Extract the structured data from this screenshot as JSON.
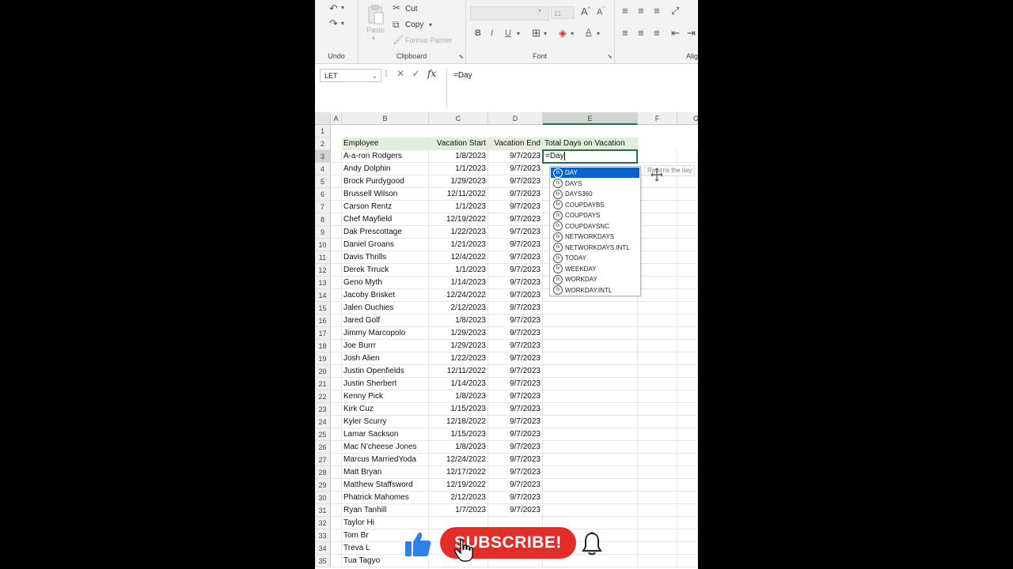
{
  "ribbon": {
    "undo_label": "Undo",
    "clipboard_label": "Clipboard",
    "font_label": "Font",
    "alignment_label": "Alig",
    "cut_label": "Cut",
    "copy_label": "Copy",
    "paste_label": "Paste",
    "format_painter_label": "Format Painter",
    "font_size": "11"
  },
  "formula_bar": {
    "name_box": "LET",
    "formula": "=Day"
  },
  "columns": [
    "A",
    "B",
    "C",
    "D",
    "E",
    "F",
    "G"
  ],
  "header_row": {
    "row": "2",
    "employee": "Employee",
    "vacation_start": "Vacation Start",
    "vacation_end": "Vacation End",
    "total_days": "Total Days on Vacation"
  },
  "active_cell": {
    "value": "=Day"
  },
  "rows": [
    {
      "num": "3",
      "name": "A-a-ron Rodgers",
      "start": "1/8/2023",
      "end": "9/7/2023"
    },
    {
      "num": "4",
      "name": "Andy Dolphin",
      "start": "1/1/2023",
      "end": "9/7/2023"
    },
    {
      "num": "5",
      "name": "Brock Purdygood",
      "start": "1/29/2023",
      "end": "9/7/2023"
    },
    {
      "num": "6",
      "name": "Brussell Wilson",
      "start": "12/11/2022",
      "end": "9/7/2023"
    },
    {
      "num": "7",
      "name": "Carson Rentz",
      "start": "1/1/2023",
      "end": "9/7/2023"
    },
    {
      "num": "8",
      "name": "Chef Mayfield",
      "start": "12/19/2022",
      "end": "9/7/2023"
    },
    {
      "num": "9",
      "name": "Dak Prescottage",
      "start": "1/22/2023",
      "end": "9/7/2023"
    },
    {
      "num": "10",
      "name": "Daniel Groans",
      "start": "1/21/2023",
      "end": "9/7/2023"
    },
    {
      "num": "11",
      "name": "Davis Thrills",
      "start": "12/4/2022",
      "end": "9/7/2023"
    },
    {
      "num": "12",
      "name": "Derek Trruck",
      "start": "1/1/2023",
      "end": "9/7/2023"
    },
    {
      "num": "13",
      "name": "Geno Myth",
      "start": "1/14/2023",
      "end": "9/7/2023"
    },
    {
      "num": "14",
      "name": "Jacoby Brisket",
      "start": "12/24/2022",
      "end": "9/7/2023"
    },
    {
      "num": "15",
      "name": "Jalen Ouchies",
      "start": "2/12/2023",
      "end": "9/7/2023"
    },
    {
      "num": "16",
      "name": "Jared Golf",
      "start": "1/8/2023",
      "end": "9/7/2023"
    },
    {
      "num": "17",
      "name": "Jimmy Marcopolo",
      "start": "1/29/2023",
      "end": "9/7/2023"
    },
    {
      "num": "18",
      "name": "Joe Burrr",
      "start": "1/29/2023",
      "end": "9/7/2023"
    },
    {
      "num": "19",
      "name": "Josh Alien",
      "start": "1/22/2023",
      "end": "9/7/2023"
    },
    {
      "num": "20",
      "name": "Justin Openfields",
      "start": "12/11/2022",
      "end": "9/7/2023"
    },
    {
      "num": "21",
      "name": "Justin Sherbert",
      "start": "1/14/2023",
      "end": "9/7/2023"
    },
    {
      "num": "22",
      "name": "Kenny Pick",
      "start": "1/8/2023",
      "end": "9/7/2023"
    },
    {
      "num": "23",
      "name": "Kirk Cuz",
      "start": "1/15/2023",
      "end": "9/7/2023"
    },
    {
      "num": "24",
      "name": "Kyler Scurry",
      "start": "12/18/2022",
      "end": "9/7/2023"
    },
    {
      "num": "25",
      "name": "Lamar Sackson",
      "start": "1/15/2023",
      "end": "9/7/2023"
    },
    {
      "num": "26",
      "name": "Mac N'cheese Jones",
      "start": "1/8/2023",
      "end": "9/7/2023"
    },
    {
      "num": "27",
      "name": "Marcus MarriedYoda",
      "start": "12/24/2022",
      "end": "9/7/2023"
    },
    {
      "num": "28",
      "name": "Matt Bryan",
      "start": "12/17/2022",
      "end": "9/7/2023"
    },
    {
      "num": "29",
      "name": "Matthew Staffsword",
      "start": "12/19/2022",
      "end": "9/7/2023"
    },
    {
      "num": "30",
      "name": "Phatrick Mahomes",
      "start": "2/12/2023",
      "end": "9/7/2023"
    },
    {
      "num": "31",
      "name": "Ryan Tanhill",
      "start": "1/7/2023",
      "end": "9/7/2023"
    },
    {
      "num": "32",
      "name": "Taylor Hi",
      "start": "",
      "end": ""
    },
    {
      "num": "33",
      "name": "Tom Br",
      "start": "",
      "end": ""
    },
    {
      "num": "34",
      "name": "Treva L",
      "start": "",
      "end": ""
    },
    {
      "num": "35",
      "name": "Tua Tagyo",
      "start": "",
      "end": ""
    }
  ],
  "empty_rows": [
    "1"
  ],
  "autocomplete": {
    "items": [
      "DAY",
      "DAYS",
      "DAYS360",
      "COUPDAYBS",
      "COUPDAYS",
      "COUPDAYSNC",
      "NETWORKDAYS",
      "NETWORKDAYS.INTL",
      "TODAY",
      "WEEKDAY",
      "WORKDAY",
      "WORKDAY.INTL"
    ],
    "tooltip": "Returns the day"
  },
  "overlay": {
    "subscribe_label": "SUBSCRIBE!",
    "subscribe_color": "#e52d27",
    "like_color": "#2f80ed"
  },
  "colors": {
    "excel_green": "#217346",
    "header_fill": "#e2efda",
    "selection_blue": "#0a63c9"
  }
}
